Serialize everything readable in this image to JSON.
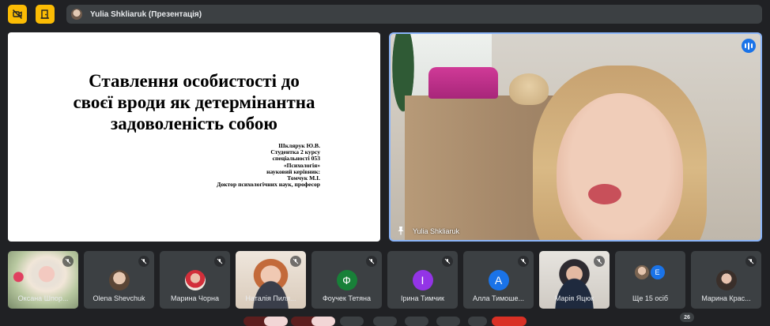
{
  "top_bar": {
    "presenter_label": "Yulia Shkliaruk (Презентація)",
    "accent_color": "#fbbc04",
    "buttons": [
      {
        "icon": "camera-off-icon"
      },
      {
        "icon": "door-exit-icon"
      }
    ]
  },
  "slide": {
    "title_lines": [
      "Ставлення особистості до",
      "своєї вроди як детермінантна",
      "задоволеність собою"
    ],
    "meta_lines": [
      "Шклярук Ю.В.",
      "Студентка 2 курсу",
      "спеціальності 053",
      "«Психологія»",
      "науковий керівник:",
      "Томчук М.І.",
      "Доктор психологічних наук, професор"
    ]
  },
  "speaker": {
    "name": "Yulia Shkliaruk",
    "border_color": "#8ab4f8"
  },
  "participants": [
    {
      "name": "Оксана Шпор...",
      "kind": "photo",
      "muted": true
    },
    {
      "name": "Olena Shevchuk",
      "kind": "small-photo",
      "muted": true
    },
    {
      "name": "Марина Чорна",
      "kind": "small-photo",
      "muted": true
    },
    {
      "name": "Наталія Пиля...",
      "kind": "photo",
      "muted": true
    },
    {
      "name": "Фоучек Тетяна",
      "kind": "initial",
      "initial": "Ф",
      "color": "#188038",
      "muted": true
    },
    {
      "name": "Ірина Тимчик",
      "kind": "initial",
      "initial": "І",
      "color": "#9334e6",
      "muted": true
    },
    {
      "name": "Алла Тимоше...",
      "kind": "initial",
      "initial": "А",
      "color": "#1a73e8",
      "muted": true
    },
    {
      "name": "Марія Яцюк",
      "kind": "photo",
      "muted": true
    },
    {
      "name": "Ще 15 осіб",
      "kind": "more",
      "initial": "E",
      "color": "#1a73e8",
      "muted": false
    },
    {
      "name": "Марина Крас...",
      "kind": "small-photo",
      "muted": true
    }
  ],
  "participant_count": "26"
}
